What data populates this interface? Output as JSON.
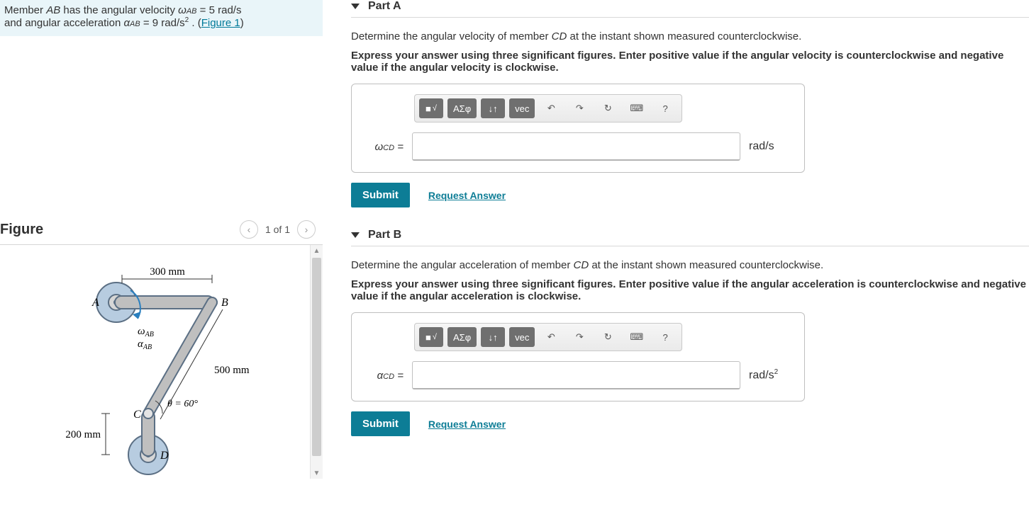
{
  "intro": {
    "line1_pre": "Member ",
    "line1_memb": "AB",
    "line1_mid": " has the angular velocity ",
    "omega_sym": "ω",
    "sub_ab": "AB",
    "eq1": " = 5  rad/s",
    "line2_pre": "and angular acceleration ",
    "alpha_sym": "α",
    "eq2": " = 9  rad/s",
    "sq": "2",
    "dot": " . (",
    "fig_link": "Figure 1",
    "close": ")"
  },
  "figure": {
    "title": "Figure",
    "page": "1 of 1",
    "dim_ab": "300 mm",
    "dim_bc": "500 mm",
    "dim_cd": "200 mm",
    "theta": "θ = 60°",
    "A": "A",
    "B": "B",
    "C": "C",
    "D": "D",
    "w": "ω",
    "a": "α",
    "sub": "AB"
  },
  "partA": {
    "title": "Part A",
    "prompt_pre": "Determine the angular velocity of member ",
    "memb": "CD",
    "prompt_post": " at the instant shown measured counterclockwise.",
    "instr": "Express your answer using three significant figures. Enter positive value if the angular velocity is counterclockwise and negative value if the angular velocity is clockwise.",
    "var_sym": "ω",
    "var_sub": "CD",
    "eq": " =",
    "unit": "rad/s",
    "submit": "Submit",
    "req": "Request Answer"
  },
  "partB": {
    "title": "Part B",
    "prompt_pre": "Determine the angular acceleration of member ",
    "memb": "CD",
    "prompt_post": " at the instant shown measured counterclockwise.",
    "instr": "Express your answer using three significant figures. Enter positive value if the angular acceleration is counterclockwise and negative value if the angular acceleration is clockwise.",
    "var_sym": "α",
    "var_sub": "CD",
    "eq": " =",
    "unit_pre": "rad/s",
    "unit_sup": "2",
    "submit": "Submit",
    "req": "Request Answer"
  },
  "toolbar": {
    "t1": "■",
    "t2_html": "x√",
    "t3": "ΑΣφ",
    "t4": "↓↑",
    "t5": "vec",
    "undo": "↶",
    "redo": "↷",
    "reset": "↻",
    "kb": "⌨",
    "help": "?"
  }
}
